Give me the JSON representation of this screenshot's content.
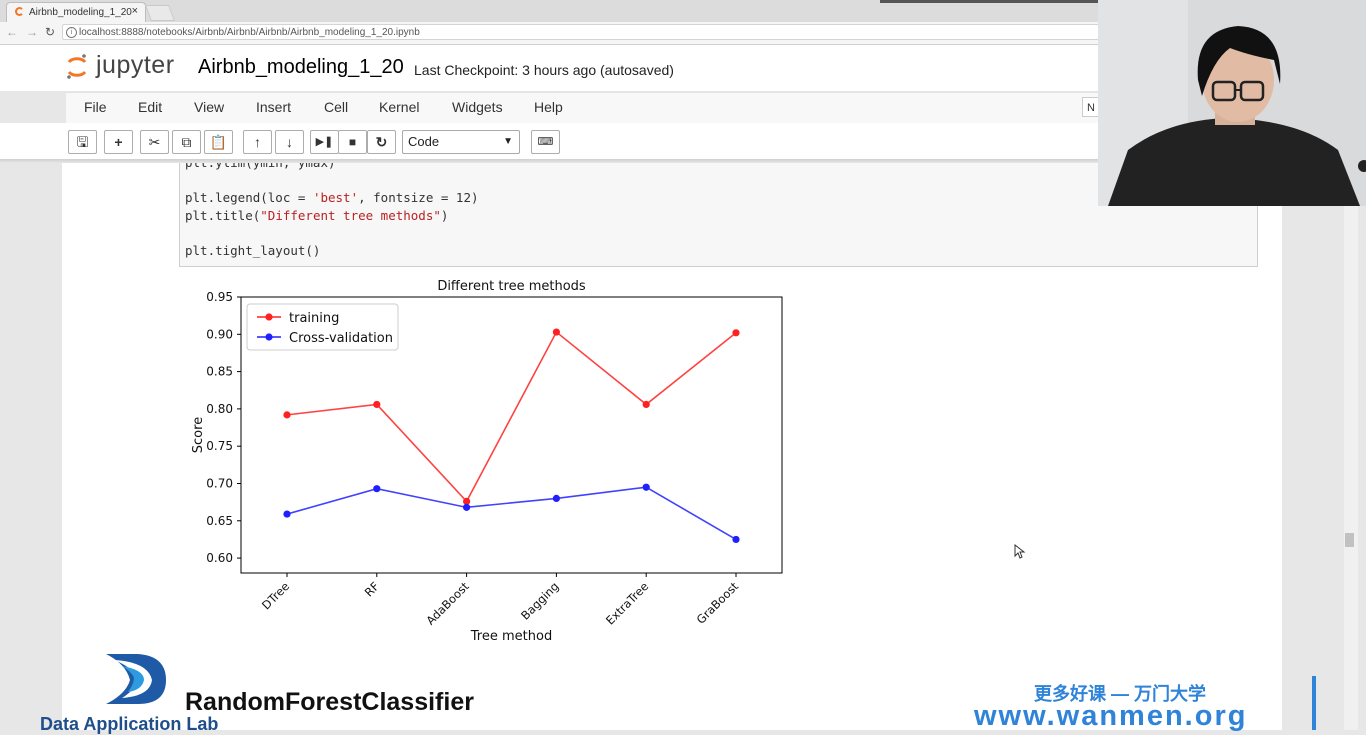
{
  "browser": {
    "tab_title": "Airbnb_modeling_1_20",
    "tab_close": "×",
    "url": "localhost:8888/notebooks/Airbnb/Airbnb/Airbnb/Airbnb_modeling_1_20.ipynb"
  },
  "jupyter": {
    "logo": "jupyter",
    "notebook_title": "Airbnb_modeling_1_20",
    "checkpoint": "Last Checkpoint: 3 hours ago (autosaved)",
    "menu": [
      "File",
      "Edit",
      "View",
      "Insert",
      "Cell",
      "Kernel",
      "Widgets",
      "Help"
    ],
    "kernel_indicator": "N",
    "cell_type": "Code",
    "toolbar_icons": [
      "save-icon",
      "plus-icon",
      "cut-icon",
      "copy-icon",
      "paste-icon",
      "arrow-up-icon",
      "arrow-down-icon",
      "step-icon",
      "stop-icon",
      "restart-icon",
      "keyboard-icon"
    ]
  },
  "code_lines": {
    "line1": "plt.ylim(ymin, ymax)",
    "line2_a": "plt.legend(loc = ",
    "line2_s": "'best'",
    "line2_b": ", fontsize = 12)",
    "line3_a": "plt.title(",
    "line3_s": "\"Different tree methods\"",
    "line3_b": ")",
    "line4": "plt.tight_layout()"
  },
  "chart_data": {
    "type": "line",
    "title": "Different tree methods",
    "xlabel": "Tree method",
    "ylabel": "Score",
    "categories": [
      "DTree",
      "RF",
      "AdaBoost",
      "Bagging",
      "ExtraTree",
      "GraBoost"
    ],
    "ylim": [
      0.58,
      0.95
    ],
    "yticks": [
      "0.60",
      "0.65",
      "0.70",
      "0.75",
      "0.80",
      "0.85",
      "0.90",
      "0.95"
    ],
    "legend_position": "top-left",
    "grid": false,
    "series": [
      {
        "name": "training",
        "color": "#ff2020",
        "values": [
          0.792,
          0.806,
          0.676,
          0.903,
          0.806,
          0.902
        ]
      },
      {
        "name": "Cross-validation",
        "color": "#2020ff",
        "values": [
          0.659,
          0.693,
          0.668,
          0.68,
          0.695,
          0.625
        ]
      }
    ]
  },
  "overlays": {
    "heading": "RandomForestClassifier",
    "lab_name": "Data Application Lab",
    "watermark_cn": "更多好课 — 万门大学",
    "watermark_url": "www.wanmen.org"
  }
}
